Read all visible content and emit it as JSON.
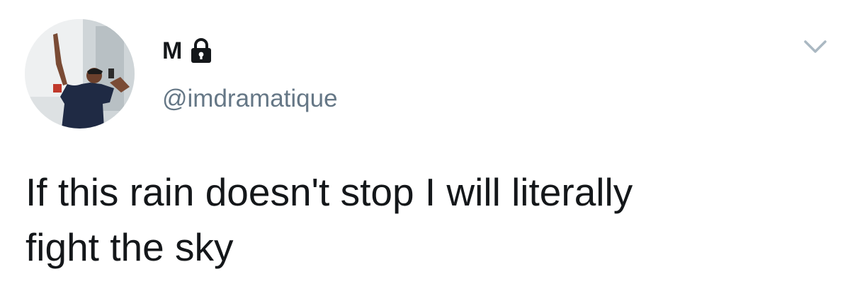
{
  "tweet": {
    "display_name": "M",
    "handle": "@imdramatique",
    "text": "If this rain doesn't stop I will literally\nfight the sky",
    "protected_icon": "lock-icon",
    "menu_icon": "chevron-down-icon",
    "avatar_icon": "avatar"
  },
  "colors": {
    "name": "#14171a",
    "handle": "#657786",
    "text": "#14171a",
    "chevron": "#aab8c2"
  }
}
